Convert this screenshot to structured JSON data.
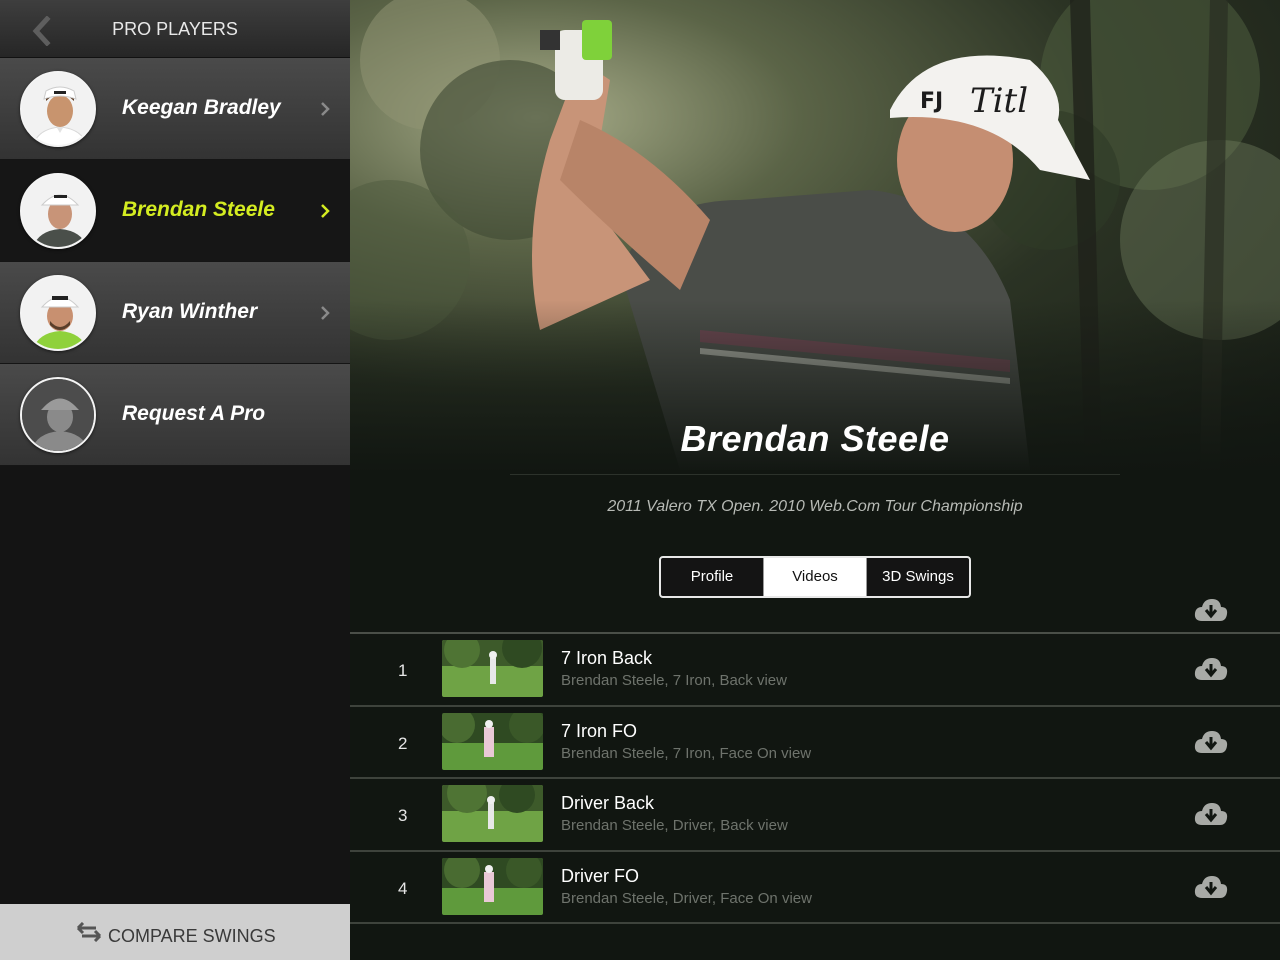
{
  "sidebar": {
    "title": "PRO PLAYERS",
    "players": [
      {
        "name": "Keegan Bradley",
        "selected": false,
        "hat": "#ffffff",
        "shirt": "#ffffff"
      },
      {
        "name": "Brendan Steele",
        "selected": true,
        "hat": "#ffffff",
        "shirt": "#4a4f4a"
      },
      {
        "name": "Ryan Winther",
        "selected": false,
        "hat": "#ffffff",
        "shirt": "#8fd13b"
      },
      {
        "name": "Request A Pro",
        "selected": false,
        "hat": "#777777",
        "shirt": "#777777"
      }
    ],
    "compare_label": "COMPARE SWINGS"
  },
  "main": {
    "player_title": "Brendan Steele",
    "achievements": "2011 Valero TX Open. 2010 Web.Com Tour Championship",
    "tabs": [
      {
        "label": "Profile",
        "active": false
      },
      {
        "label": "Videos",
        "active": true
      },
      {
        "label": "3D Swings",
        "active": false
      }
    ],
    "videos": [
      {
        "number": "1",
        "title": "7 Iron Back",
        "subtitle": "Brendan Steele, 7 Iron, Back view"
      },
      {
        "number": "2",
        "title": "7 Iron FO",
        "subtitle": "Brendan Steele, 7 Iron, Face On view"
      },
      {
        "number": "3",
        "title": "Driver Back",
        "subtitle": "Brendan Steele, Driver, Back view"
      },
      {
        "number": "4",
        "title": "Driver FO",
        "subtitle": "Brendan Steele, Driver, Face On view"
      }
    ]
  },
  "colors": {
    "accent_selected": "#d4ec21",
    "sidebar_bg": "#141414",
    "main_bg": "#111611"
  },
  "icons": {
    "back": "chevron-left-icon",
    "row_chevron": "chevron-right-icon",
    "download": "cloud-download-icon",
    "compare": "swap-arrows-icon"
  }
}
